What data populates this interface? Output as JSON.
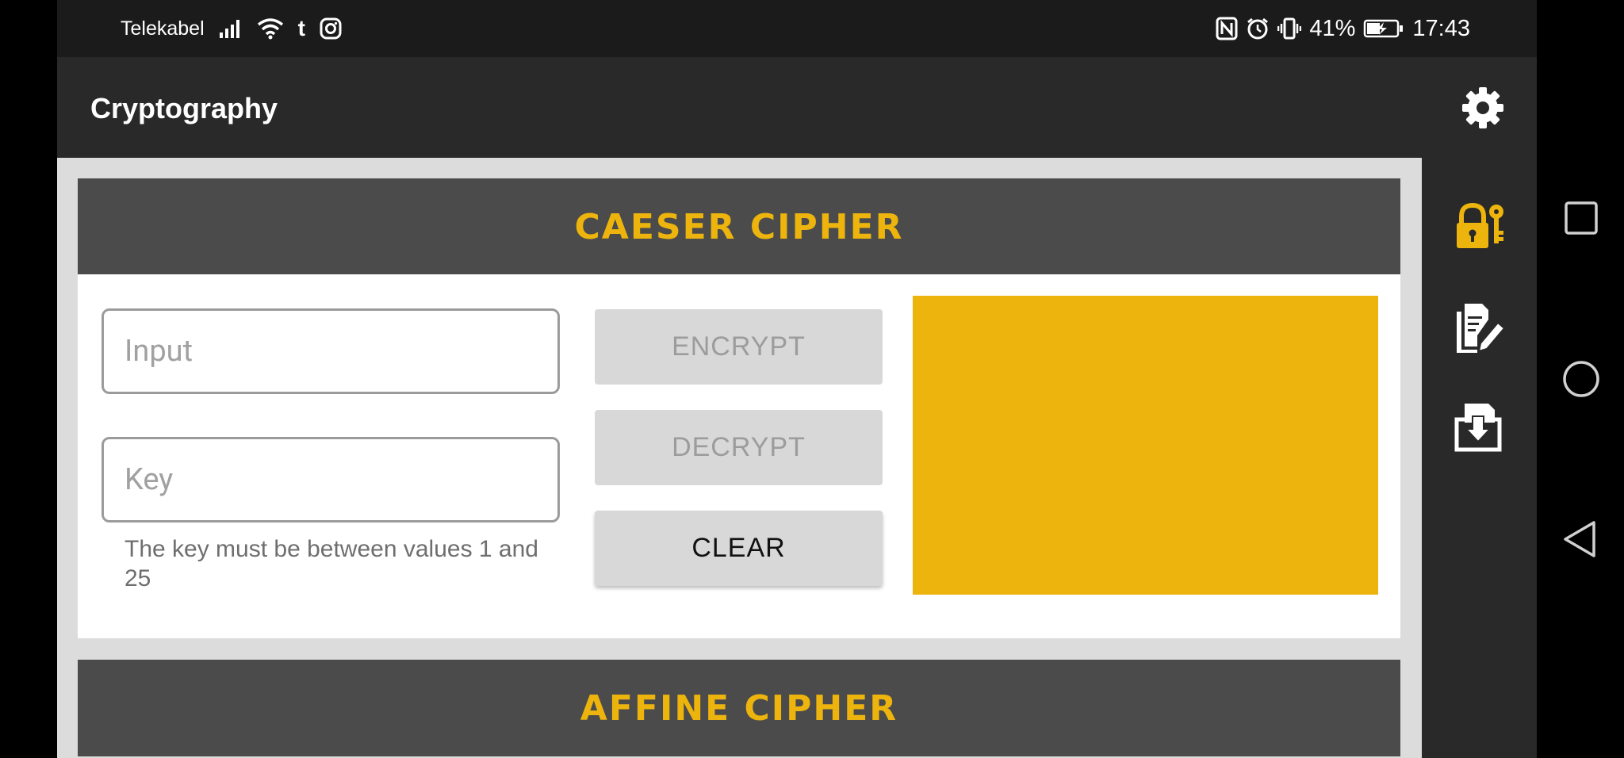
{
  "status_bar": {
    "carrier": "Telekabel",
    "battery": "41%",
    "time": "17:43",
    "icons": [
      "signal-icon",
      "wifi-icon",
      "tumblr-icon",
      "instagram-icon",
      "nfc-icon",
      "alarm-icon",
      "vibrate-icon",
      "battery-charging-icon"
    ]
  },
  "app_bar": {
    "title": "Cryptography",
    "settings_icon": "gear-icon"
  },
  "side_rail": {
    "items": [
      "lock-key-icon",
      "document-edit-icon",
      "download-folder-icon"
    ]
  },
  "caesar": {
    "title": "CAESER CIPHER",
    "input": {
      "placeholder": "Input",
      "value": ""
    },
    "key": {
      "placeholder": "Key",
      "value": ""
    },
    "helper": "The key must be between values 1 and 25",
    "encrypt_label": "ENCRYPT",
    "decrypt_label": "DECRYPT",
    "clear_label": "CLEAR",
    "output": ""
  },
  "affine": {
    "title": "AFFINE CIPHER"
  },
  "nav_bar": {
    "items": [
      "recents-square-icon",
      "home-circle-icon",
      "back-triangle-icon"
    ]
  },
  "colors": {
    "accent": "#ECB40C",
    "app_bar": "#292929",
    "card_header": "#4B4B4B",
    "content_bg": "#DCDCDC",
    "button": "#D8D8D8"
  }
}
